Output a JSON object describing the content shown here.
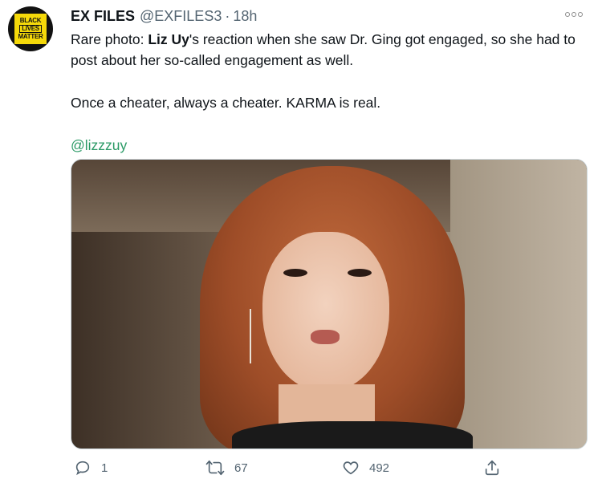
{
  "tweet": {
    "avatar_text": [
      "BLACK",
      "LIVES",
      "MATTER"
    ],
    "display_name": "EX FILES",
    "handle": "@EXFILES3",
    "separator": "·",
    "time": "18h",
    "text": {
      "line1_prefix": "Rare photo: ",
      "line1_bold": "Liz Uy",
      "line1_suffix": "'s reaction when she saw Dr. Ging got engaged, so she had to post about her so-called engagement as well.",
      "paragraph2": "Once a cheater, always a cheater. KARMA is real.",
      "mention": "@lizzzuy"
    }
  },
  "actions": {
    "reply_count": "1",
    "retweet_count": "67",
    "like_count": "492"
  },
  "colors": {
    "mention": "#2b9a66",
    "muted": "#536471",
    "avatar_yellow": "#f5d90a"
  },
  "icons": [
    "more-icon",
    "reply-icon",
    "retweet-icon",
    "like-icon",
    "share-icon"
  ]
}
